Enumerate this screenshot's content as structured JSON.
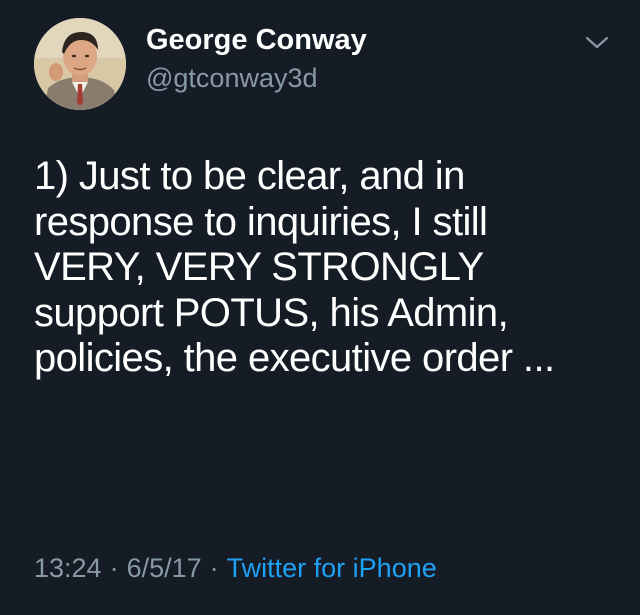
{
  "tweet": {
    "author": {
      "display_name": "George Conway",
      "handle": "@gtconway3d",
      "avatar_icon": "profile-photo-illustration"
    },
    "menu_icon": "chevron-down-icon",
    "text": "1) Just to be clear, and in\nresponse to inquiries, I still\nVERY, VERY STRONGLY\nsupport POTUS, his Admin,\npolicies, the executive order ...",
    "time": "13:24",
    "date": "6/5/17",
    "separator": "·",
    "source": "Twitter for iPhone"
  },
  "colors": {
    "background": "#151c26",
    "primary_text": "#ffffff",
    "secondary_text": "#8899a6",
    "link": "#1da1f2"
  }
}
